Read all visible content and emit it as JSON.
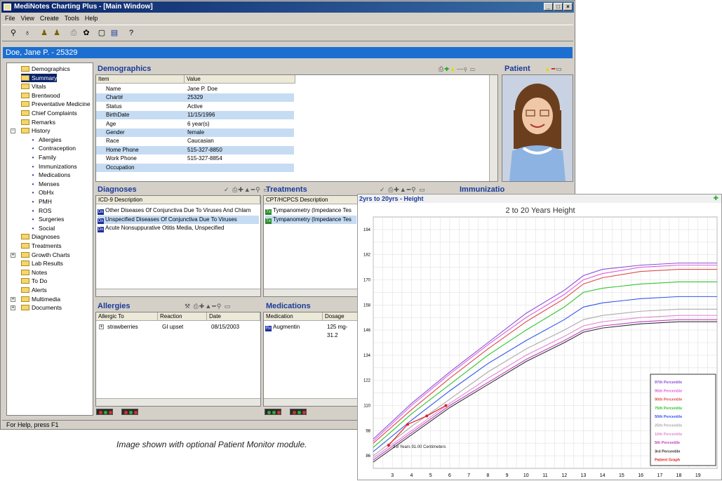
{
  "window": {
    "title": "MediNotes Charting Plus - [Main Window]"
  },
  "menu": [
    "File",
    "View",
    "Create",
    "Tools",
    "Help"
  ],
  "patient_bar": "Doe, Jane P. - 25329",
  "tree": [
    {
      "label": "Demographics",
      "icon": "person-icon"
    },
    {
      "label": "Summary",
      "icon": "folder-open-icon",
      "selected": true
    },
    {
      "label": "Vitals",
      "icon": "folder-icon"
    },
    {
      "label": "Brentwood",
      "icon": "folder-icon"
    },
    {
      "label": "Preventative Medicine",
      "icon": "folder-icon"
    },
    {
      "label": "Chief Complaints",
      "icon": "folder-icon"
    },
    {
      "label": "Remarks",
      "icon": "folder-icon"
    },
    {
      "label": "History",
      "icon": "folder-open-icon",
      "expander": "-"
    },
    {
      "label": "Allergies",
      "icon": "allergy-icon",
      "child": true
    },
    {
      "label": "Contraception",
      "icon": "contraception-icon",
      "child": true
    },
    {
      "label": "Family",
      "icon": "family-icon",
      "child": true
    },
    {
      "label": "Immunizations",
      "icon": "syringe-icon",
      "child": true
    },
    {
      "label": "Medications",
      "icon": "pill-icon",
      "child": true
    },
    {
      "label": "Menses",
      "icon": "menses-icon",
      "child": true
    },
    {
      "label": "ObHx",
      "icon": "obhx-icon",
      "child": true
    },
    {
      "label": "PMH",
      "icon": "pmh-icon",
      "child": true
    },
    {
      "label": "ROS",
      "icon": "ros-icon",
      "child": true
    },
    {
      "label": "Surgeries",
      "icon": "scalpel-icon",
      "child": true
    },
    {
      "label": "Social",
      "icon": "social-icon",
      "child": true
    },
    {
      "label": "Diagnoses",
      "icon": "folder-icon"
    },
    {
      "label": "Treatments",
      "icon": "folder-icon"
    },
    {
      "label": "Growth Charts",
      "icon": "folder-icon",
      "expander": "+"
    },
    {
      "label": "Lab Results",
      "icon": "folder-icon"
    },
    {
      "label": "Notes",
      "icon": "folder-icon"
    },
    {
      "label": "To Do",
      "icon": "folder-icon"
    },
    {
      "label": "Alerts",
      "icon": "folder-icon"
    },
    {
      "label": "Multimedia",
      "icon": "folder-icon",
      "expander": "+"
    },
    {
      "label": "Documents",
      "icon": "folder-icon",
      "expander": "+"
    }
  ],
  "demographics": {
    "title": "Demographics",
    "columns": [
      "Item",
      "Value"
    ],
    "rows": [
      [
        "Name",
        "Jane P. Doe"
      ],
      [
        "Chart#",
        "25329"
      ],
      [
        "Status",
        "Active"
      ],
      [
        "BirthDate",
        "11/15/1996"
      ],
      [
        "Age",
        "6 year(s)"
      ],
      [
        "Gender",
        "female"
      ],
      [
        "Race",
        "Caucasian"
      ],
      [
        "Home Phone",
        "515-327-8850"
      ],
      [
        "Work Phone",
        "515-327-8854"
      ],
      [
        "Occupation",
        ""
      ]
    ]
  },
  "patient_panel": {
    "title": "Patient"
  },
  "diagnoses": {
    "title": "Diagnoses",
    "column": "ICD-9 Description",
    "rows": [
      "Other Diseases Of Conjunctiva Due To Viruses And Chlam",
      "Unspecified Diseases Of Conjunctiva Due To Viruses",
      "Acute Nonsuppurative Otitis Media, Unspecified"
    ]
  },
  "treatments": {
    "title": "Treatments",
    "column": "CPT/HCPCS Description",
    "rows": [
      "Tympanometry (Impedance Tes",
      "Tympanometry (Impedance Tes"
    ]
  },
  "immunizations": {
    "title": "Immunizatio"
  },
  "allergies": {
    "title": "Allergies",
    "columns": [
      "Allergic To",
      "Reaction",
      "Date"
    ],
    "rows": [
      [
        "strawberries",
        "GI upset",
        "08/15/2003"
      ]
    ]
  },
  "medications": {
    "title": "Medications",
    "columns": [
      "Medication",
      "Dosage"
    ],
    "rows": [
      [
        "Augmentin",
        "125 mg-31.2"
      ]
    ]
  },
  "status": "For Help, press F1",
  "caption": "Image shown with optional Patient Monitor module.",
  "chart_window": {
    "title": "2yrs to 20yrs - Height"
  },
  "chart_data": {
    "type": "line",
    "title": "2 to 20 Years Height",
    "xlim": [
      2,
      20
    ],
    "ylim": [
      80,
      200
    ],
    "x_ticks": [
      3,
      4,
      5,
      6,
      7,
      8,
      9,
      10,
      11,
      12,
      13,
      14,
      15,
      16,
      17,
      18,
      19
    ],
    "y_ticks": [
      86,
      98,
      110,
      122,
      134,
      146,
      158,
      170,
      182,
      194
    ],
    "x": [
      2,
      4,
      6,
      8,
      10,
      12,
      13,
      14,
      16,
      18,
      20
    ],
    "series": [
      {
        "name": "97th Percentile",
        "color": "#8a4fd8",
        "values": [
          94,
          111,
          126,
          140,
          154,
          165,
          172,
          175,
          177,
          178,
          178
        ]
      },
      {
        "name": "95th Percentile",
        "color": "#e05be0",
        "values": [
          93,
          110,
          125,
          139,
          152,
          163,
          170,
          173,
          176,
          177,
          177
        ]
      },
      {
        "name": "90th Percentile",
        "color": "#e04a4a",
        "values": [
          92,
          108,
          123,
          137,
          150,
          161,
          168,
          171,
          174,
          175,
          175
        ]
      },
      {
        "name": "75th Percentile",
        "color": "#2fc42f",
        "values": [
          90,
          106,
          120,
          134,
          146,
          157,
          164,
          166,
          168,
          169,
          169
        ]
      },
      {
        "name": "50th Percentile",
        "color": "#3355ee",
        "values": [
          88,
          103,
          117,
          130,
          141,
          151,
          157,
          159,
          161,
          162,
          162
        ]
      },
      {
        "name": "25th Percentile",
        "color": "#aaaaaa",
        "values": [
          86,
          100,
          113,
          126,
          137,
          146,
          151,
          153,
          155,
          156,
          156
        ]
      },
      {
        "name": "10th Percentile",
        "color": "#e08ad0",
        "values": [
          85,
          98,
          111,
          123,
          134,
          143,
          148,
          150,
          152,
          153,
          153
        ]
      },
      {
        "name": "5th Percentile",
        "color": "#c040c0",
        "values": [
          84,
          97,
          110,
          121,
          132,
          141,
          146,
          148,
          150,
          151,
          151
        ]
      },
      {
        "name": "3rd Percentile",
        "color": "#333333",
        "values": [
          83,
          96,
          109,
          120,
          131,
          140,
          145,
          147,
          149,
          150,
          150
        ]
      }
    ],
    "patient": {
      "name": "Patient Graph",
      "color": "#e02020",
      "x": [
        2.8,
        3.8,
        4.8,
        5.8
      ],
      "values": [
        91,
        101,
        105,
        110
      ]
    },
    "annotation": "2.8 Years 91.00 Centimeters"
  }
}
